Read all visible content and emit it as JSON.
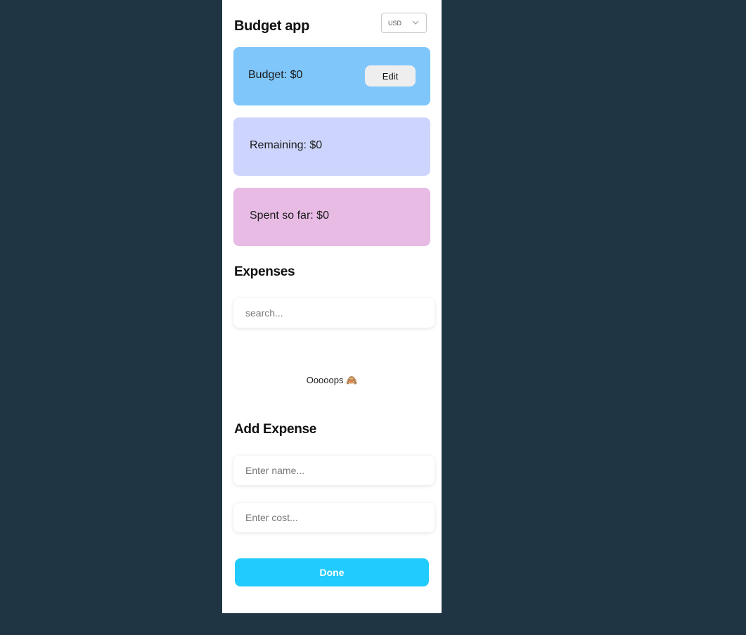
{
  "app": {
    "title": "Budget app",
    "currency": "USD"
  },
  "cards": {
    "budget": "Budget: $0",
    "edit_label": "Edit",
    "remaining": "Remaining: $0",
    "spent": "Spent so far: $0"
  },
  "expenses": {
    "title": "Expenses",
    "search_placeholder": "search...",
    "empty_text": "Ooooops 🙈"
  },
  "add_expense": {
    "title": "Add Expense",
    "name_placeholder": "Enter name...",
    "cost_placeholder": "Enter cost...",
    "done_label": "Done"
  },
  "colors": {
    "background": "#1f3543",
    "budget_card": "#7fc6fb",
    "remaining_card": "#cdd5fe",
    "spent_card": "#e8bbe5",
    "done_button": "#22cbfd"
  }
}
